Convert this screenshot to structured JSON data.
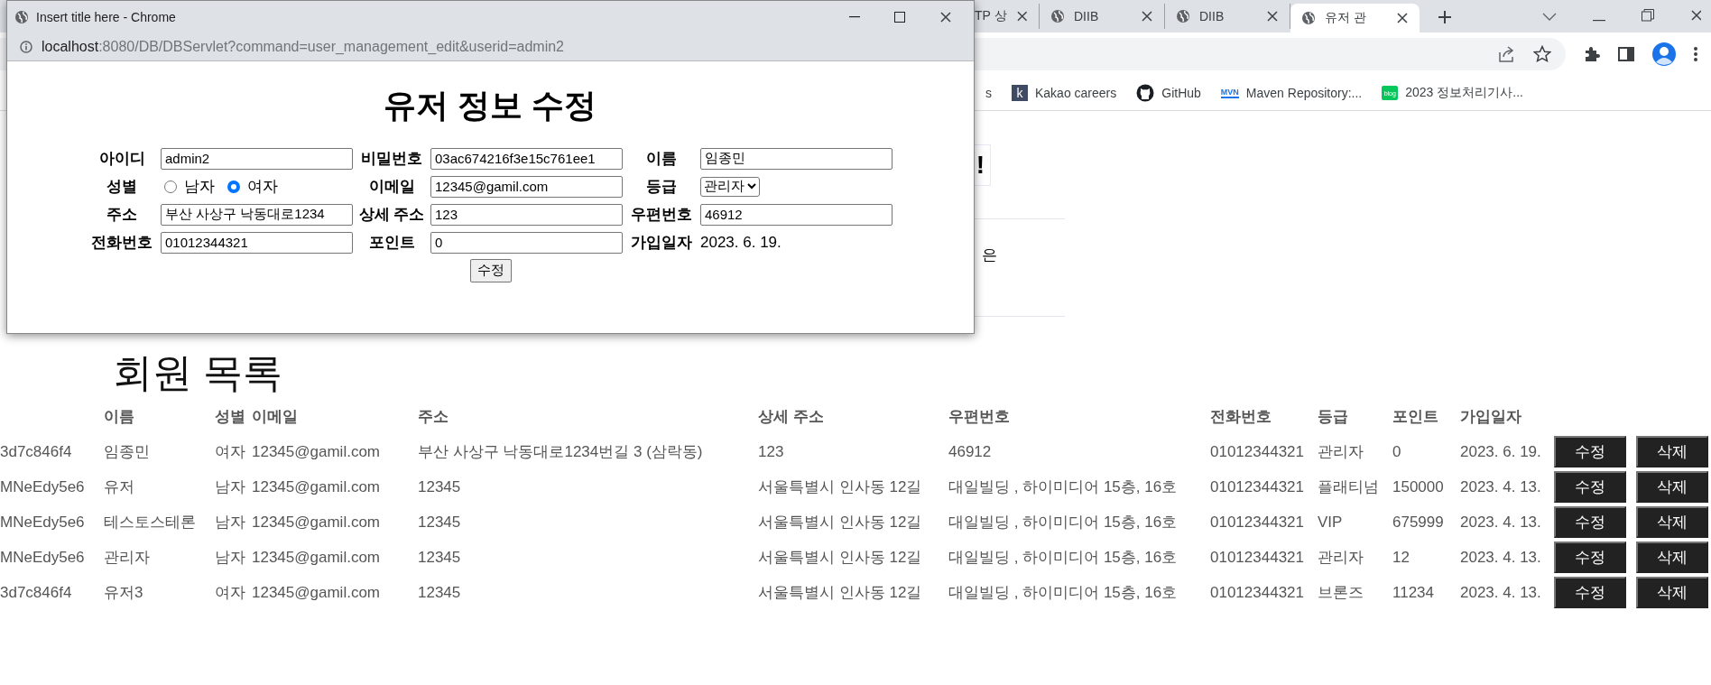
{
  "browser": {
    "tabs": [
      {
        "label": "TP 상",
        "selected": false
      },
      {
        "label": "DIIB",
        "selected": false
      },
      {
        "label": "DIIB",
        "selected": false
      },
      {
        "label": "유저 관",
        "selected": true
      }
    ],
    "bookmarks": [
      {
        "kind": "text",
        "label": "s"
      },
      {
        "kind": "letter",
        "icon_text": "k",
        "label": "Kakao careers"
      },
      {
        "kind": "round",
        "label": "GitHub"
      },
      {
        "kind": "wordmark",
        "icon_text": "MVN",
        "label": "Maven Repository:..."
      },
      {
        "kind": "blog",
        "icon_text": "blog",
        "label": "2023 정보처리기사..."
      }
    ]
  },
  "page": {
    "fragments": [
      {
        "kind": "boxed",
        "text": "!"
      },
      {
        "kind": "plain",
        "text": "은"
      }
    ],
    "heading": "회원 목록",
    "table": {
      "columns": [
        "",
        "이름",
        "성별",
        "이메일",
        "주소",
        "상세 주소",
        "우편번호",
        "전화번호",
        "등급",
        "포인트",
        "가입일자"
      ],
      "rows": [
        {
          "cells": [
            "3d7c846f4",
            "임종민",
            "여자",
            "12345@gamil.com",
            "부산 사상구 낙동대로1234번길 3 (삼락동)",
            "123",
            "46912",
            "01012344321",
            "관리자",
            "0",
            "2023. 6. 19."
          ],
          "actions": [
            "수정",
            "삭제"
          ]
        },
        {
          "cells": [
            "MNeEdy5e6",
            "유저",
            "남자",
            "12345@gamil.com",
            "12345",
            "서울특별시 인사동 12길",
            "대일빌딩 , 하이미디어 15층, 16호",
            "01012344321",
            "플래티넘",
            "150000",
            "2023. 4. 13."
          ],
          "actions": [
            "수정",
            "삭제"
          ]
        },
        {
          "cells": [
            "MNeEdy5e6",
            "테스토스테론",
            "남자",
            "12345@gamil.com",
            "12345",
            "서울특별시 인사동 12길",
            "대일빌딩 , 하이미디어 15층, 16호",
            "01012344321",
            "VIP",
            "675999",
            "2023. 4. 13."
          ],
          "actions": [
            "수정",
            "삭제"
          ]
        },
        {
          "cells": [
            "MNeEdy5e6",
            "관리자",
            "남자",
            "12345@gamil.com",
            "12345",
            "서울특별시 인사동 12길",
            "대일빌딩 , 하이미디어 15층, 16호",
            "01012344321",
            "관리자",
            "12",
            "2023. 4. 13."
          ],
          "actions": [
            "수정",
            "삭제"
          ]
        },
        {
          "cells": [
            "3d7c846f4",
            "유저3",
            "여자",
            "12345@gamil.com",
            "12345",
            "서울특별시 인사동 12길",
            "대일빌딩 , 하이미디어 15층, 16호",
            "01012344321",
            "브론즈",
            "11234",
            "2023. 4. 13."
          ],
          "actions": [
            "수정",
            "삭제"
          ]
        }
      ]
    }
  },
  "popup": {
    "title": "Insert title here - Chrome",
    "url": {
      "host": "localhost",
      "path": ":8080/DB/DBServlet?command=user_management_edit&userid=admin2"
    },
    "heading": "유저 정보 수정",
    "form": [
      {
        "cells": [
          {
            "label": "아이디",
            "kind": "text",
            "value": "admin2"
          },
          {
            "label": "비밀번호",
            "kind": "text",
            "value": "03ac674216f3e15c761ee1"
          },
          {
            "label": "이름",
            "kind": "text",
            "value": "임종민"
          }
        ]
      },
      {
        "cells": [
          {
            "label": "성별",
            "kind": "radio",
            "options": [
              {
                "label": "남자",
                "selected": false
              },
              {
                "label": "여자",
                "selected": true
              }
            ]
          },
          {
            "label": "이메일",
            "kind": "text",
            "value": "12345@gamil.com"
          },
          {
            "label": "등급",
            "kind": "select",
            "value": "관리자"
          }
        ]
      },
      {
        "cells": [
          {
            "label": "주소",
            "kind": "text",
            "value": "부산 사상구 낙동대로1234"
          },
          {
            "label": "상세 주소",
            "kind": "text",
            "value": "123"
          },
          {
            "label": "우편번호",
            "kind": "text",
            "value": "46912"
          }
        ]
      },
      {
        "cells": [
          {
            "label": "전화번호",
            "kind": "text",
            "value": "01012344321"
          },
          {
            "label": "포인트",
            "kind": "text",
            "value": "0"
          },
          {
            "label": "가입일자",
            "kind": "date",
            "value": "2023. 6. 19."
          }
        ]
      }
    ],
    "submit": "수정"
  }
}
